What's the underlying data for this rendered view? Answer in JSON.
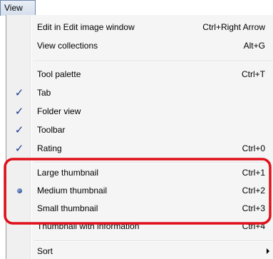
{
  "menubar": {
    "view_label": "View"
  },
  "menu": {
    "items": [
      {
        "label": "Edit in Edit image window",
        "shortcut": "Ctrl+Right Arrow"
      },
      {
        "label": "View collections",
        "shortcut": "Alt+G"
      },
      {
        "label": "Tool palette",
        "shortcut": "Ctrl+T"
      },
      {
        "label": "Tab",
        "shortcut": "",
        "checked": true
      },
      {
        "label": "Folder view",
        "shortcut": "",
        "checked": true
      },
      {
        "label": "Toolbar",
        "shortcut": "",
        "checked": true
      },
      {
        "label": "Rating",
        "shortcut": "Ctrl+0",
        "checked": true
      },
      {
        "label": "Large thumbnail",
        "shortcut": "Ctrl+1"
      },
      {
        "label": "Medium thumbnail",
        "shortcut": "Ctrl+2",
        "selected": true
      },
      {
        "label": "Small thumbnail",
        "shortcut": "Ctrl+3"
      },
      {
        "label": "Thumbnail with information",
        "shortcut": "Ctrl+4"
      },
      {
        "label": "Sort",
        "shortcut": "",
        "submenu": true
      }
    ]
  },
  "colors": {
    "highlight_frame": "#e0101a",
    "check_mark": "#1a3d8f"
  }
}
